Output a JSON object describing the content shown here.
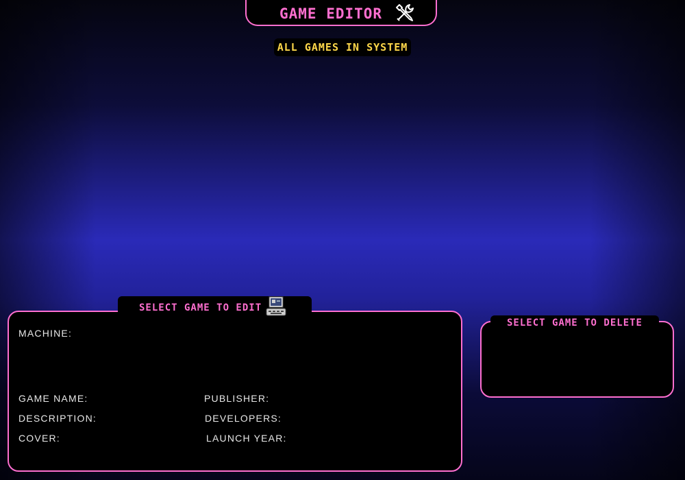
{
  "header": {
    "title": "GAME EDITOR",
    "icon": "wrench-screwdriver-icon"
  },
  "games_section": {
    "label": "ALL GAMES IN SYSTEM"
  },
  "edit_panel": {
    "tab_label": "SELECT GAME TO EDIT",
    "tab_icon": "computer-icon",
    "fields": {
      "machine": "MACHINE:",
      "game_name": "GAME NAME:",
      "description": "DESCRIPTION:",
      "cover": "COVER:",
      "publisher": "PUBLISHER:",
      "developers": "DEVELOPERS:",
      "launch_year": "LAUNCH YEAR:"
    }
  },
  "delete_panel": {
    "tab_label": "SELECT GAME TO DELETE"
  },
  "colors": {
    "accent_pink": "#ff6fd0",
    "accent_yellow": "#ffd84a",
    "panel_bg": "#000000",
    "background_blue": "#2a2ab8"
  }
}
